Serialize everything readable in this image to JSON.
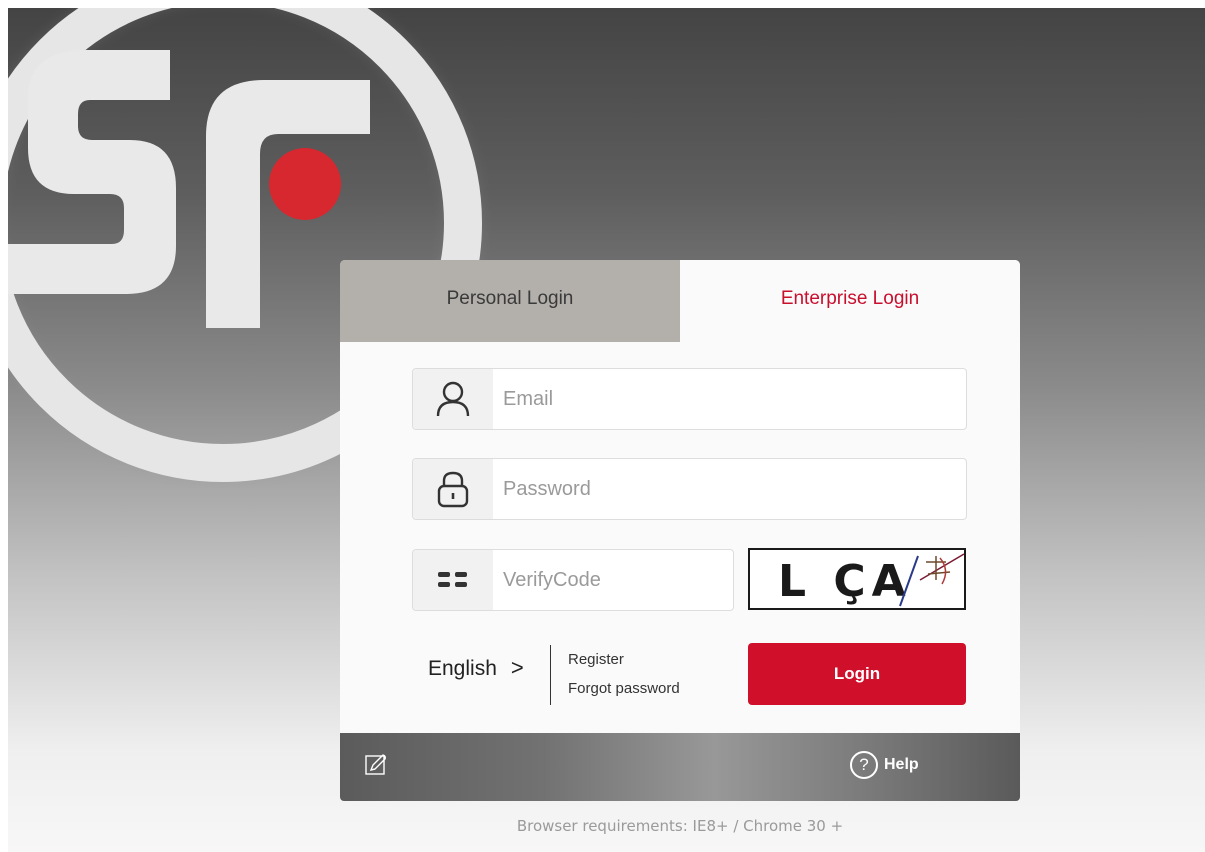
{
  "brand": {
    "logo_text": "SF",
    "accent_color": "#c8102e",
    "dot_color": "#d7282f"
  },
  "tabs": [
    {
      "label": "Personal Login",
      "active": false
    },
    {
      "label": "Enterprise Login",
      "active": true
    }
  ],
  "form": {
    "email": {
      "placeholder": "Email",
      "value": "",
      "icon": "user-icon"
    },
    "password": {
      "placeholder": "Password",
      "value": "",
      "icon": "lock-icon"
    },
    "verify": {
      "placeholder": "VerifyCode",
      "value": "",
      "icon": "code-icon"
    },
    "captcha_text": "L ÇA",
    "language": "English",
    "language_arrow": ">",
    "register_label": "Register",
    "forgot_label": "Forgot password",
    "login_label": "Login"
  },
  "footer": {
    "edit_icon": "edit-icon",
    "help_label": "Help",
    "help_symbol": "?"
  },
  "browser_requirements": "Browser requirements: IE8+ / Chrome 30 +"
}
